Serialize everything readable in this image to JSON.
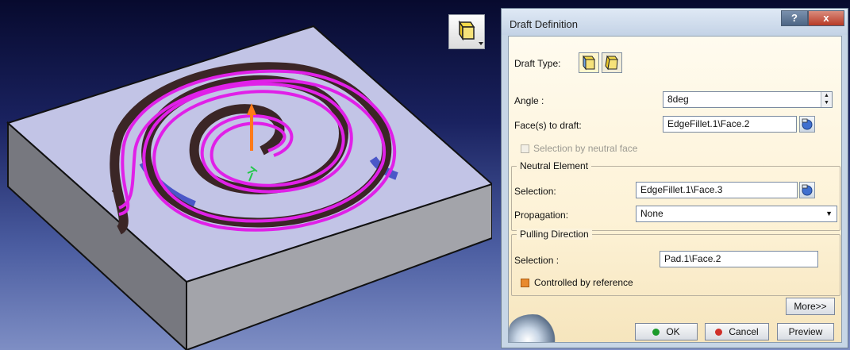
{
  "dialog": {
    "title": "Draft Definition",
    "help_label": "?",
    "close_label": "x",
    "draft_type_label": "Draft Type:",
    "angle_label": "Angle :",
    "angle_value": "8deg",
    "faces_label": "Face(s) to draft:",
    "faces_value": "EdgeFillet.1\\Face.2",
    "neutral_checkbox_label": "Selection by neutral face",
    "neutral_checkbox_checked": false,
    "neutral_group": {
      "title": "Neutral Element",
      "selection_label": "Selection:",
      "selection_value": "EdgeFillet.1\\Face.3",
      "propagation_label": "Propagation:",
      "propagation_value": "None"
    },
    "pulling_group": {
      "title": "Pulling Direction",
      "selection_label": "Selection :",
      "selection_value": "Pad.1\\Face.2",
      "controlled_label": "Controlled by reference",
      "controlled_checked": true
    },
    "more_label": "More>>",
    "ok_label": "OK",
    "cancel_label": "Cancel",
    "preview_label": "Preview"
  },
  "colors": {
    "spiral_highlight": "#e020e8",
    "part_top": "#c2c4e6",
    "groove": "#3b2626",
    "arrow": "#ff7a1a",
    "ok_dot": "#1b9a2a",
    "cancel_dot": "#d0302a"
  }
}
